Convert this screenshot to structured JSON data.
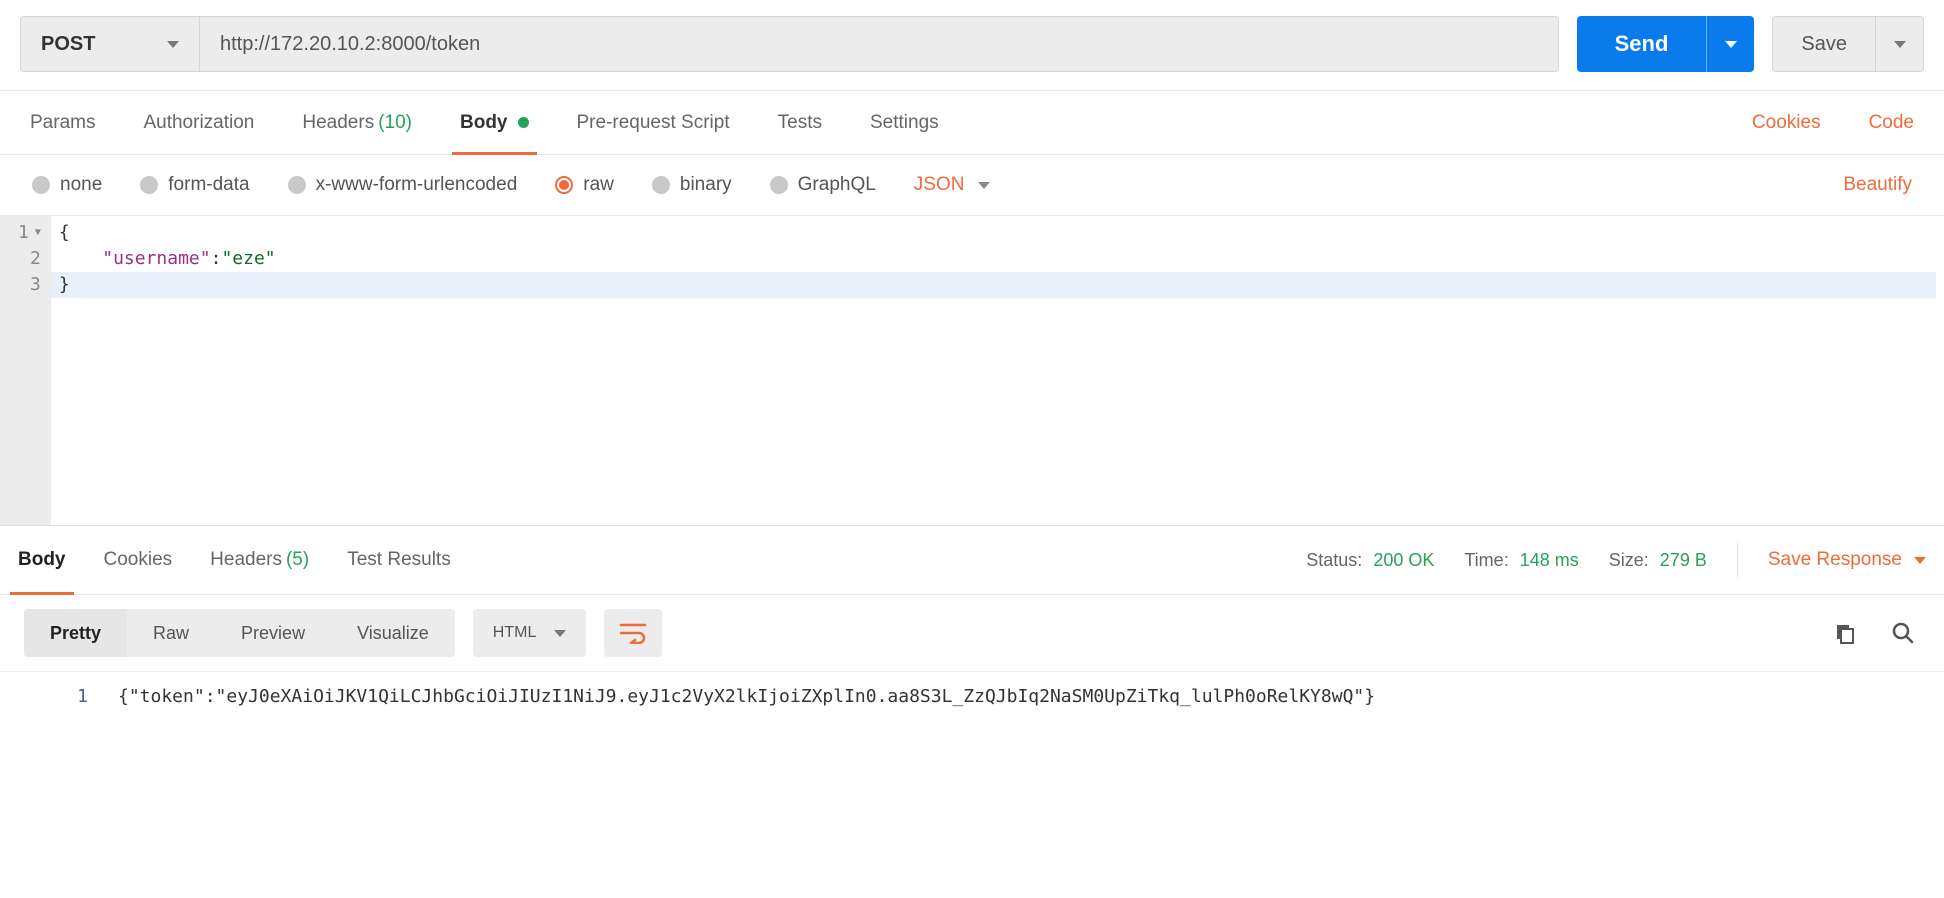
{
  "request": {
    "method": "POST",
    "url": "http://172.20.10.2:8000/token",
    "send_label": "Send",
    "save_label": "Save"
  },
  "req_tabs": {
    "params": "Params",
    "authorization": "Authorization",
    "headers_label": "Headers",
    "headers_count": "(10)",
    "body": "Body",
    "prerequest": "Pre-request Script",
    "tests": "Tests",
    "settings": "Settings",
    "cookies_link": "Cookies",
    "code_link": "Code"
  },
  "body_types": {
    "none": "none",
    "formdata": "form-data",
    "urlencoded": "x-www-form-urlencoded",
    "raw": "raw",
    "binary": "binary",
    "graphql": "GraphQL",
    "content_type": "JSON",
    "beautify": "Beautify"
  },
  "request_body": {
    "ln1": "1",
    "ln2": "2",
    "ln3": "3",
    "line1": "{",
    "line2_indent": "    ",
    "line2_key": "\"username\"",
    "line2_colon": ":",
    "line2_val": "\"eze\"",
    "line3": "}"
  },
  "resp_tabs": {
    "body": "Body",
    "cookies": "Cookies",
    "headers_label": "Headers",
    "headers_count": "(5)",
    "testresults": "Test Results"
  },
  "resp_meta": {
    "status_label": "Status:",
    "status_value": "200 OK",
    "time_label": "Time:",
    "time_value": "148 ms",
    "size_label": "Size:",
    "size_value": "279 B",
    "save_response": "Save Response"
  },
  "resp_toolbar": {
    "pretty": "Pretty",
    "raw": "Raw",
    "preview": "Preview",
    "visualize": "Visualize",
    "lang": "HTML"
  },
  "response_body": {
    "ln1": "1",
    "text": "{\"token\":\"eyJ0eXAiOiJKV1QiLCJhbGciOiJIUzI1NiJ9.eyJ1c2VyX2lkIjoiZXplIn0.aa8S3L_ZzQJbIq2NaSM0UpZiTkq_lulPh0oRelKY8wQ\"}"
  }
}
